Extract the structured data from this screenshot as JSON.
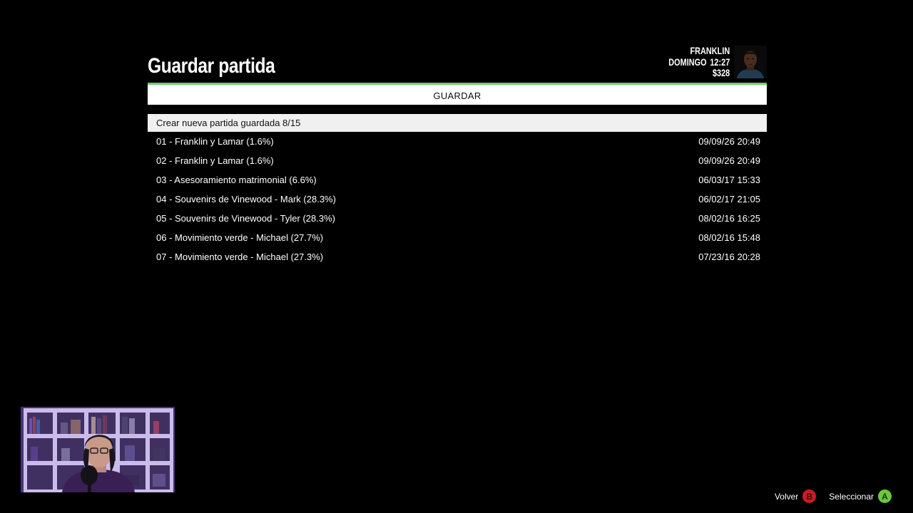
{
  "screen": {
    "title": "Guardar partida"
  },
  "player": {
    "name": "FRANKLIN",
    "day": "DOMINGO",
    "time": "12:27",
    "money": "$328",
    "avatar_icon": "character-portrait"
  },
  "tab": {
    "label": "GUARDAR",
    "accent_color": "#77c96d"
  },
  "saves": {
    "new_save_label": "Crear nueva partida guardada 8/15",
    "items": [
      {
        "name": "01 - Franklin y Lamar (1.6%)",
        "date": "09/09/26 20:49"
      },
      {
        "name": "02 - Franklin y Lamar (1.6%)",
        "date": "09/09/26 20:49"
      },
      {
        "name": "03 - Asesoramiento matrimonial (6.6%)",
        "date": "06/03/17 15:33"
      },
      {
        "name": "04 - Souvenirs de Vinewood - Mark (28.3%)",
        "date": "06/02/17 21:05"
      },
      {
        "name": "05 - Souvenirs de Vinewood - Tyler (28.3%)",
        "date": "08/02/16 16:25"
      },
      {
        "name": "06 - Movimiento verde - Michael (27.7%)",
        "date": "08/02/16 15:48"
      },
      {
        "name": "07 - Movimiento verde - Michael (27.3%)",
        "date": "07/23/16 20:28"
      }
    ]
  },
  "hints": {
    "back_label": "Volver",
    "back_button": "B",
    "back_color": "#c91c26",
    "select_label": "Seleccionar",
    "select_button": "A",
    "select_color": "#6cc83b"
  },
  "overlay": {
    "webcam_icon": "webcam-feed"
  }
}
